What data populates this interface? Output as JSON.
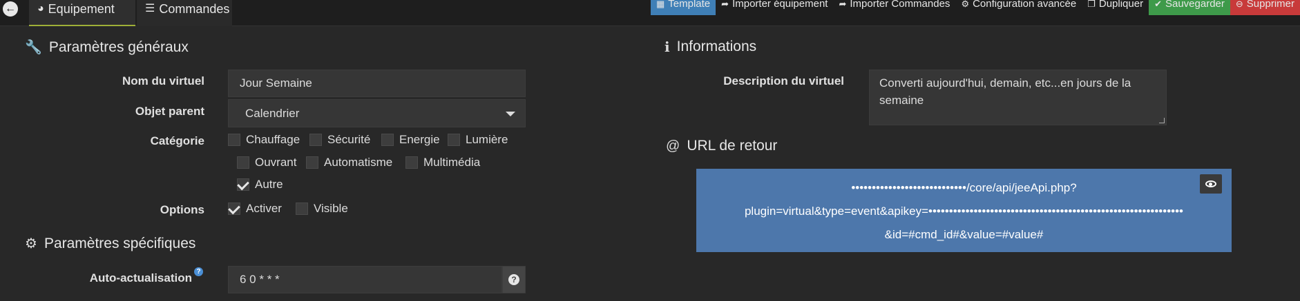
{
  "tabs": {
    "equipement": "Equipement",
    "commandes": "Commandes"
  },
  "actions": {
    "template": "Template",
    "import_equipment": "Importer équipement",
    "import_commands": "Importer Commandes",
    "advanced_config": "Configuration avancée",
    "duplicate": "Dupliquer",
    "save": "Sauvegarder",
    "delete": "Supprimer"
  },
  "general": {
    "title": "Paramètres généraux",
    "name_label": "Nom du virtuel",
    "name_value": "Jour Semaine",
    "parent_label": "Objet parent",
    "parent_value": "Calendrier",
    "category_label": "Catégorie",
    "categories": [
      {
        "label": "Chauffage",
        "checked": false
      },
      {
        "label": "Sécurité",
        "checked": false
      },
      {
        "label": "Energie",
        "checked": false
      },
      {
        "label": "Lumière",
        "checked": false
      },
      {
        "label": "Ouvrant",
        "checked": false
      },
      {
        "label": "Automatisme",
        "checked": false
      },
      {
        "label": "Multimédia",
        "checked": false
      },
      {
        "label": "Autre",
        "checked": true
      }
    ],
    "options_label": "Options",
    "options": [
      {
        "label": "Activer",
        "checked": true
      },
      {
        "label": "Visible",
        "checked": false
      }
    ]
  },
  "specific": {
    "title": "Paramètres spécifiques",
    "autorefresh_label": "Auto-actualisation",
    "autorefresh_value": "6 0 * * *"
  },
  "info": {
    "title": "Informations",
    "description_label": "Description du virtuel",
    "description_value": "Converti aujourd'hui, demain, etc...en jours de la semaine"
  },
  "url": {
    "title": "URL de retour",
    "line1": "••••••••••••••••••••••••••••/core/api/jeeApi.php?",
    "line2": "plugin=virtual&type=event&apikey=••••••••••••••••••••••••••••••••••••••••••••••••••••••••••••••",
    "line3": "&id=#cmd_id#&value=#value#"
  },
  "colors": {
    "accent_template": "#3f7fb6",
    "save": "#3e9a4a",
    "delete": "#c83a3a",
    "url_box": "#4d77ab"
  }
}
